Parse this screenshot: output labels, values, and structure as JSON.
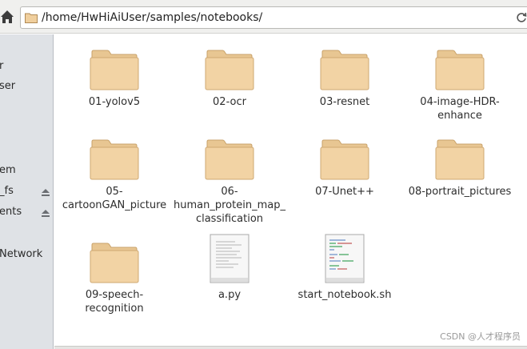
{
  "address_bar": {
    "path": "/home/HwHiAiUser/samples/notebooks/"
  },
  "sidebar": {
    "items": [
      {
        "label": "r"
      },
      {
        "label": "ser"
      },
      {
        "label": "em"
      },
      {
        "label": "_fs"
      },
      {
        "label": "ents"
      },
      {
        "label": "Network"
      }
    ]
  },
  "files": [
    {
      "name": "01-yolov5",
      "type": "folder"
    },
    {
      "name": "02-ocr",
      "type": "folder"
    },
    {
      "name": "03-resnet",
      "type": "folder"
    },
    {
      "name": "04-image-HDR-enhance",
      "type": "folder"
    },
    {
      "name": "05-cartoonGAN_picture",
      "type": "folder"
    },
    {
      "name": "06-human_protein_map_classification",
      "type": "folder"
    },
    {
      "name": "07-Unet++",
      "type": "folder"
    },
    {
      "name": "08-portrait_pictures",
      "type": "folder"
    },
    {
      "name": "09-speech-recognition",
      "type": "folder"
    },
    {
      "name": "a.py",
      "type": "python-file"
    },
    {
      "name": "start_notebook.sh",
      "type": "shell-script"
    }
  ],
  "watermark": "CSDN @人才程序员",
  "colors": {
    "folder_body": "#f2d3a4",
    "folder_tab": "#e8c692",
    "sidebar_bg": "#dfe2e6"
  }
}
